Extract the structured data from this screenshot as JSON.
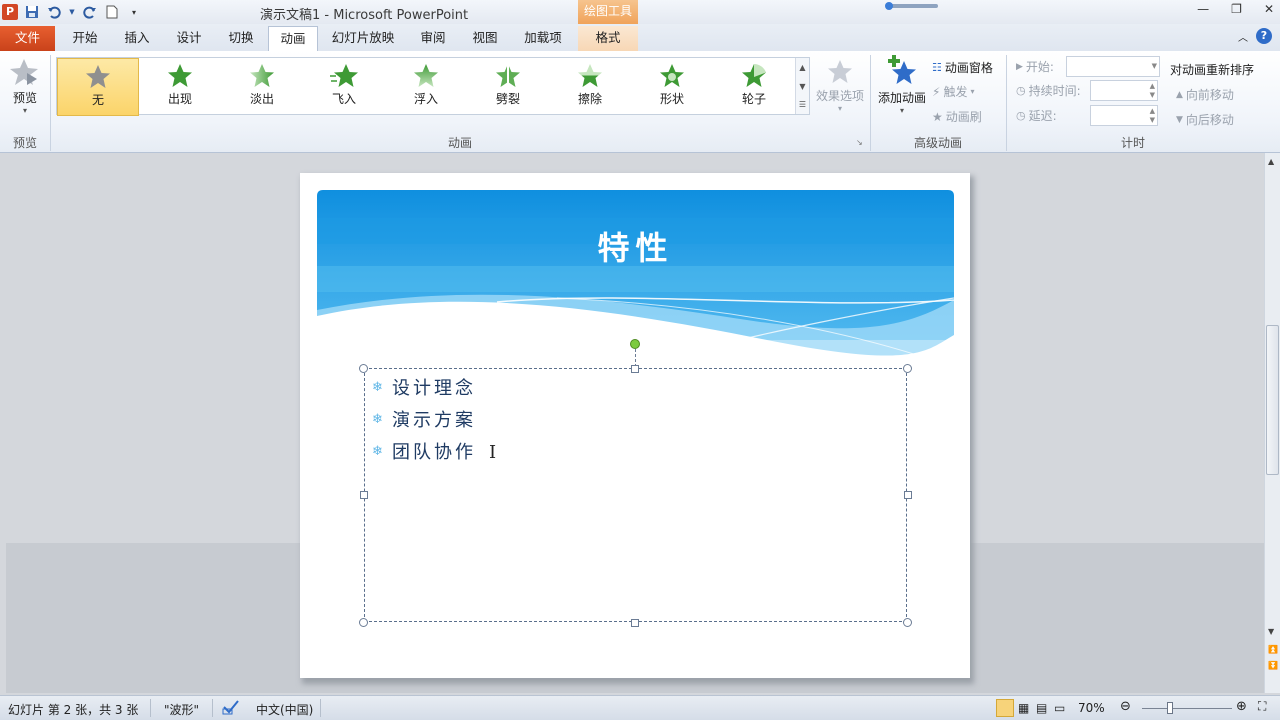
{
  "window": {
    "title": "演示文稿1 - Microsoft PowerPoint",
    "contextual_tab_group": "绘图工具",
    "app_logo": "P"
  },
  "tabs": {
    "file": "文件",
    "home": "开始",
    "insert": "插入",
    "design": "设计",
    "transitions": "切换",
    "animations": "动画",
    "slideshow": "幻灯片放映",
    "review": "审阅",
    "view": "视图",
    "addins": "加载项",
    "format": "格式"
  },
  "ribbon": {
    "preview": {
      "button": "预览",
      "group": "预览"
    },
    "animation_group_label": "动画",
    "animations": [
      "无",
      "出现",
      "淡出",
      "飞入",
      "浮入",
      "劈裂",
      "擦除",
      "形状",
      "轮子"
    ],
    "effect_options": "效果选项",
    "advanced": {
      "group": "高级动画",
      "add_animation": "添加动画",
      "animation_pane": "动画窗格",
      "trigger": "触发",
      "animation_painter": "动画刷"
    },
    "timing": {
      "group": "计时",
      "start": "开始:",
      "duration": "持续时间:",
      "delay": "延迟:",
      "reorder": "对动画重新排序",
      "move_earlier": "向前移动",
      "move_later": "向后移动"
    }
  },
  "slide": {
    "title": "特性",
    "bullets": [
      "设计理念",
      "演示方案",
      "团队协作"
    ]
  },
  "statusbar": {
    "slide_info": "幻灯片 第 2 张，共 3 张",
    "theme": "\"波形\"",
    "language": "中文(中国)",
    "zoom": "70%"
  },
  "colors": {
    "file_tab": "#d24726",
    "slide_header": "#1b9ae0",
    "bullet_text": "#1f3b63",
    "selected_animation": "#fbd46a"
  }
}
